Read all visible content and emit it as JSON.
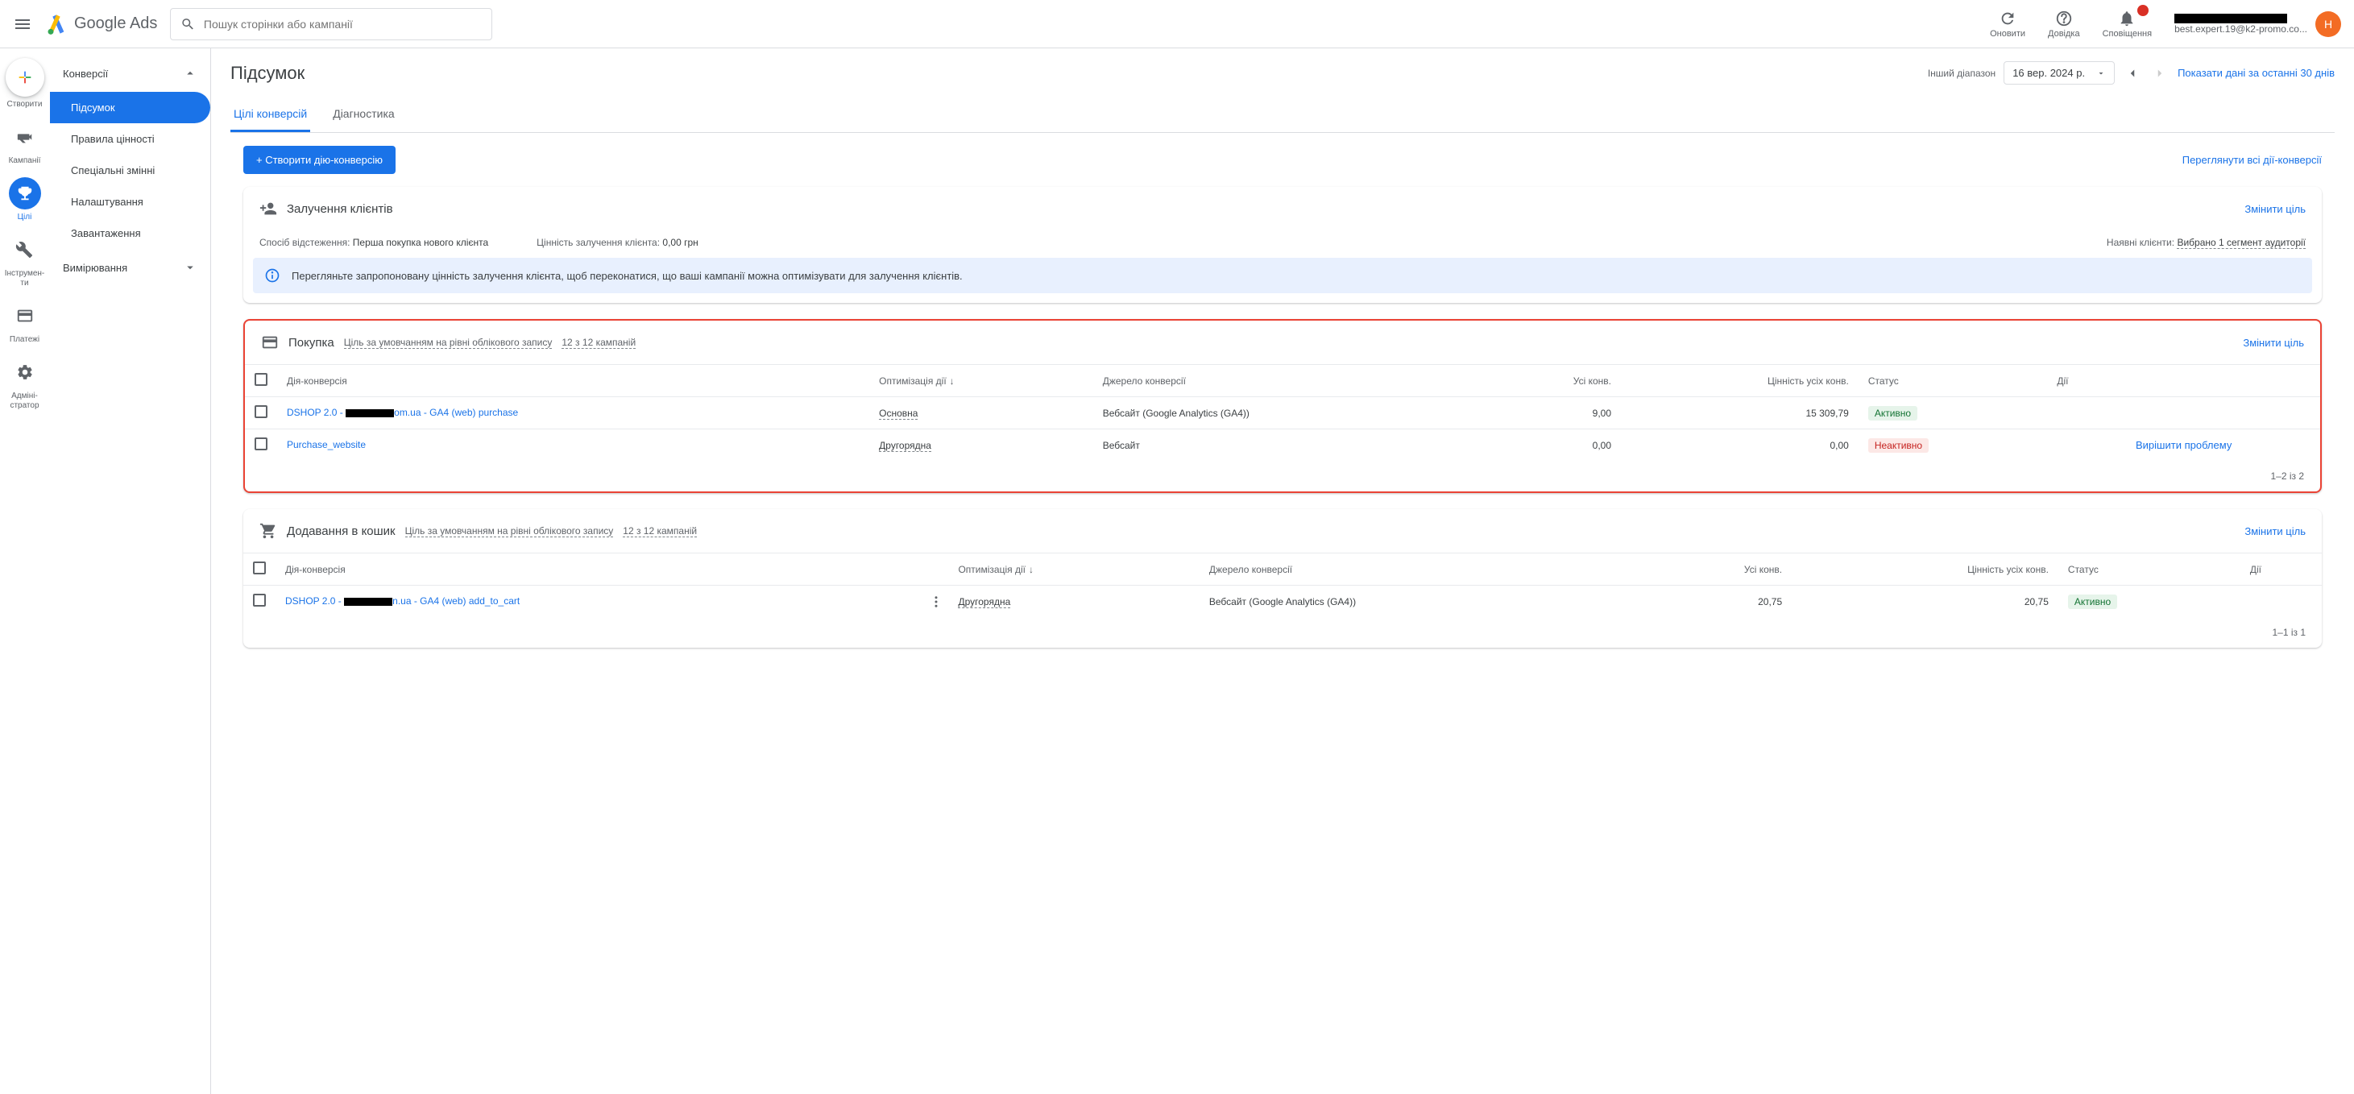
{
  "header": {
    "logo_text": "Google Ads",
    "search_placeholder": "Пошук сторінки або кампанії",
    "refresh_label": "Оновити",
    "help_label": "Довідка",
    "notifications_label": "Сповіщення",
    "account_email": "best.expert.19@k2-promo.co...",
    "avatar_letter": "Н"
  },
  "rail": {
    "create": "Створити",
    "campaigns": "Кампанії",
    "goals": "Цілі",
    "tools": "Інструмен-\nти",
    "billing": "Платежі",
    "admin": "Адміні-\nстратор"
  },
  "sidenav": {
    "group_conversions": "Конверсії",
    "item_summary": "Підсумок",
    "item_value_rules": "Правила цінності",
    "item_custom_vars": "Спеціальні змінні",
    "item_settings": "Налаштування",
    "item_downloads": "Завантаження",
    "group_measurement": "Вимірювання"
  },
  "page": {
    "title": "Підсумок",
    "tab_goals": "Цілі конверсій",
    "tab_diagnostics": "Діагностика",
    "date_range_label": "Інший діапазон",
    "date_value": "16 вер. 2024 р.",
    "last30_link": "Показати дані за останні 30 днів",
    "create_button": "+ Створити дію-конверсію",
    "view_all_link": "Переглянути всі дії-конверсії"
  },
  "acquisition_card": {
    "title": "Залучення клієнтів",
    "change_goal": "Змінити ціль",
    "tracking_label": "Спосіб відстеження:",
    "tracking_value": "Перша покупка нового клієнта",
    "value_label": "Цінність залучення клієнта:",
    "value_amount": "0,00 грн",
    "existing_label": "Наявні клієнти:",
    "existing_value": "Вибрано 1 сегмент аудиторії",
    "banner_text": "Перегляньте запропоновану цінність залучення клієнта, щоб переконатися, що ваші кампанії можна оптимізувати для залучення клієнтів."
  },
  "table_columns": {
    "action": "Дія-конверсія",
    "optimization": "Оптимізація дії",
    "source": "Джерело конверсії",
    "all_conv": "Усі конв.",
    "value_all_conv": "Цінність усіх конв.",
    "status": "Статус",
    "actions": "Дії"
  },
  "purchase_card": {
    "title": "Покупка",
    "default_goal": "Ціль за умовчанням на рівні облікового запису",
    "campaigns_link": "12 з 12 кампаній",
    "change_goal": "Змінити ціль",
    "rows": [
      {
        "name_prefix": "DSHOP 2.0 - ",
        "name_suffix": "om.ua - GA4 (web) purchase",
        "optimization": "Основна",
        "source": "Вебсайт (Google Analytics (GA4))",
        "all_conv": "9,00",
        "value": "15 309,79",
        "status": "Активно",
        "status_class": "active",
        "action_link": ""
      },
      {
        "name_prefix": "Purchase_website",
        "name_suffix": "",
        "optimization": "Другорядна",
        "source": "Вебсайт",
        "all_conv": "0,00",
        "value": "0,00",
        "status": "Неактивно",
        "status_class": "inactive",
        "action_link": "Вирішити проблему"
      }
    ],
    "footer": "1–2 із 2"
  },
  "cart_card": {
    "title": "Додавання в кошик",
    "default_goal": "Ціль за умовчанням на рівні облікового запису",
    "campaigns_link": "12 з 12 кампаній",
    "change_goal": "Змінити ціль",
    "rows": [
      {
        "name_prefix": "DSHOP 2.0 - ",
        "name_suffix": "n.ua - GA4 (web) add_to_cart",
        "optimization": "Другорядна",
        "source": "Вебсайт (Google Analytics (GA4))",
        "all_conv": "20,75",
        "value": "20,75",
        "status": "Активно",
        "status_class": "active"
      }
    ],
    "footer": "1–1 із 1"
  }
}
